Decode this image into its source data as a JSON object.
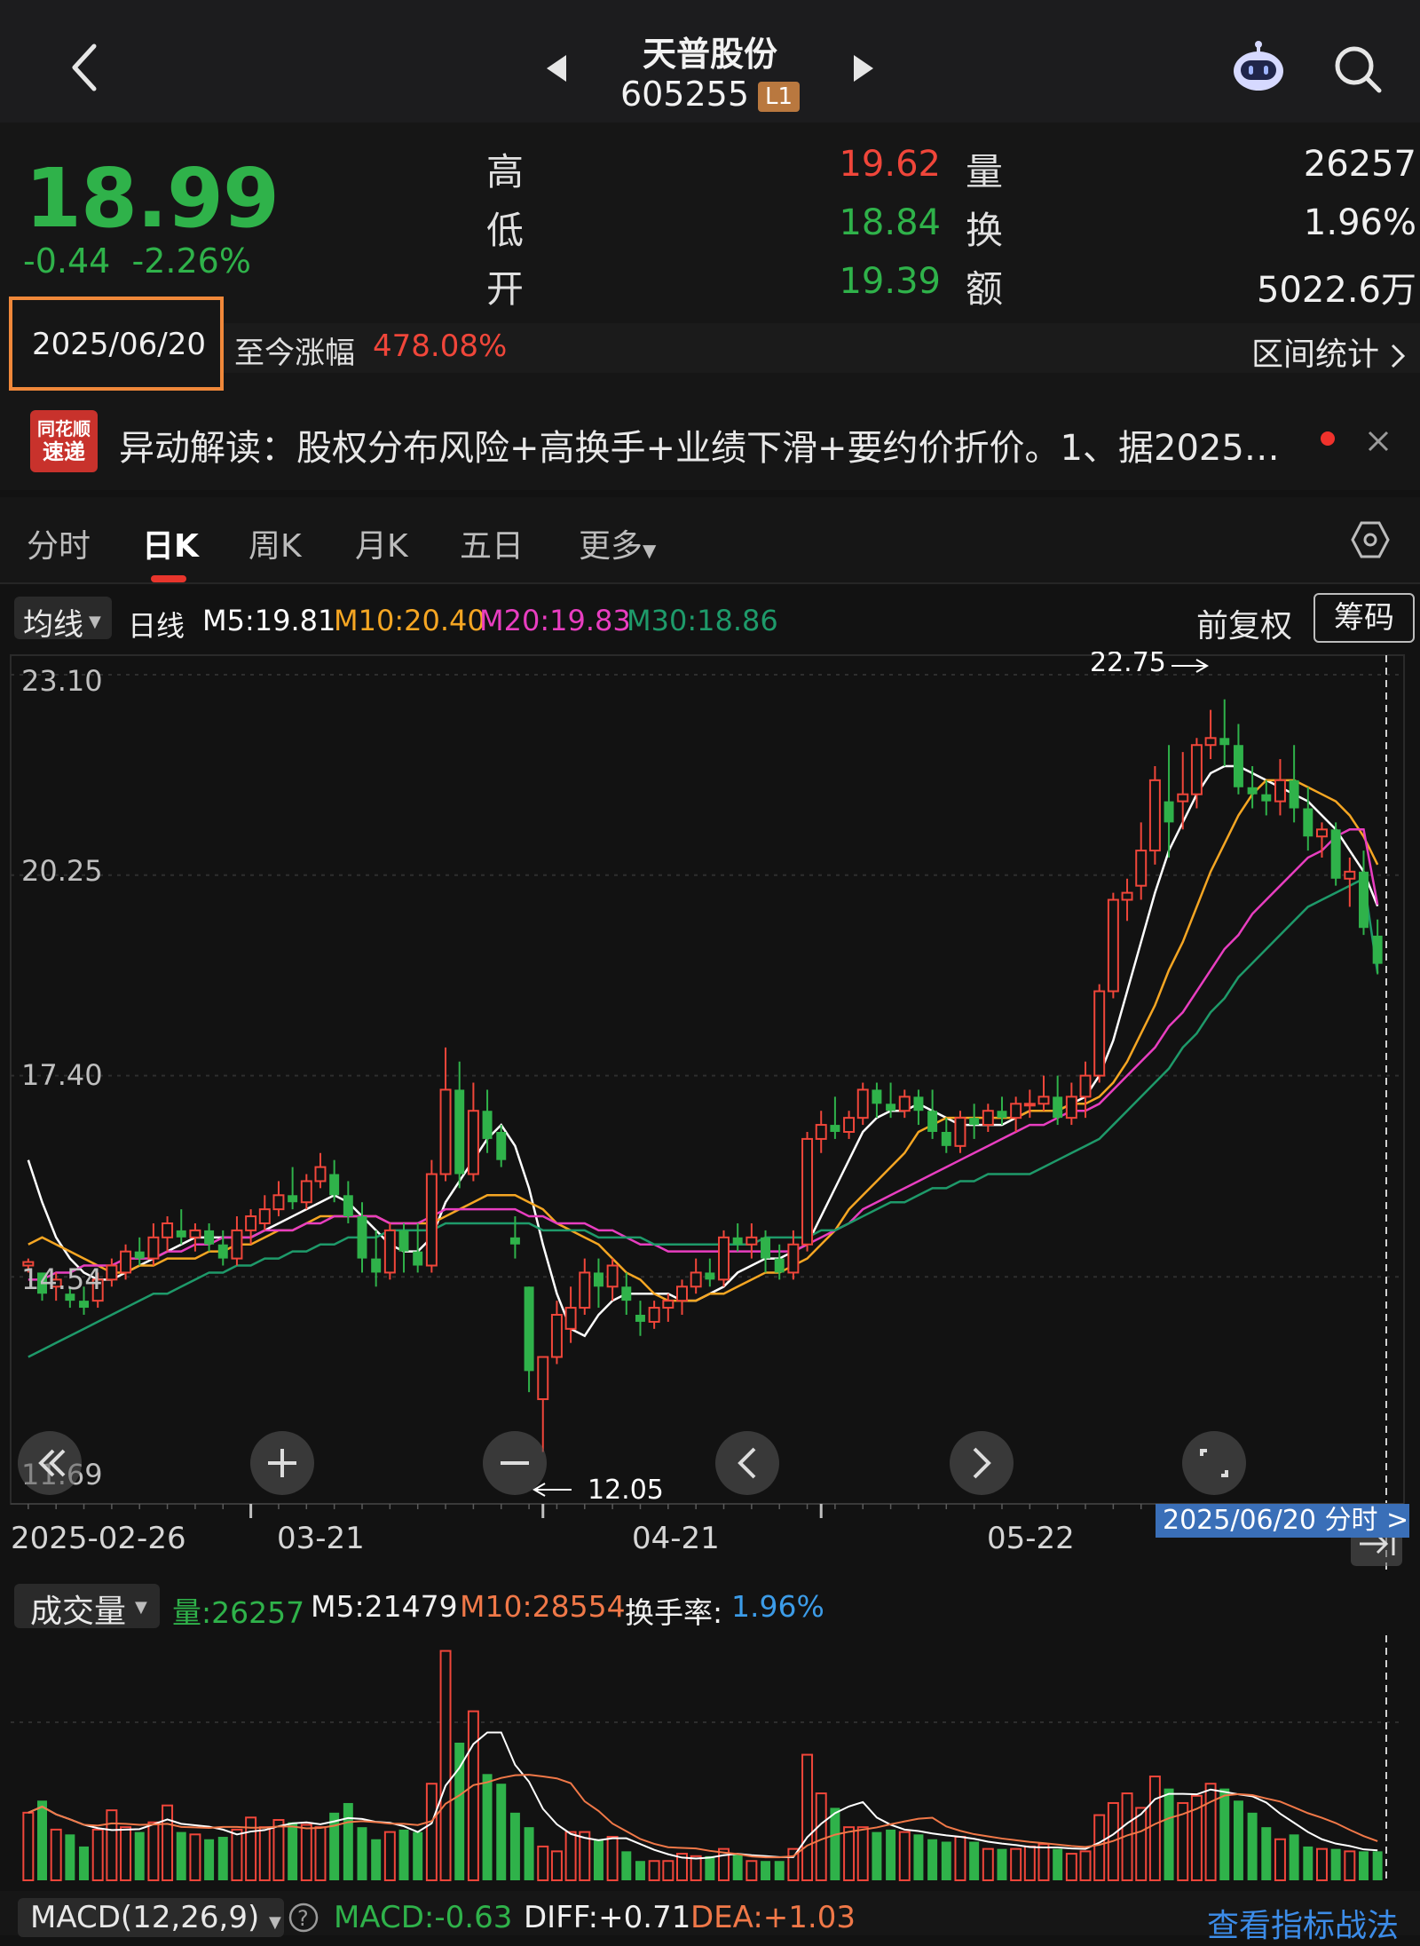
{
  "header": {
    "title": "天普股份",
    "code": "605255",
    "badge": "L1"
  },
  "quote": {
    "price": "18.99",
    "change": "-0.44",
    "change_pct": "-2.26%",
    "high_label": "高",
    "high": "19.62",
    "low_label": "低",
    "low": "18.84",
    "open_label": "开",
    "open": "19.39",
    "vol_label": "量",
    "vol": "26257",
    "turn_label": "换",
    "turn": "1.96%",
    "amt_label": "额",
    "amt": "5022.6万",
    "date": "2025/06/20",
    "since_label": "至今涨幅",
    "since_value": "478.08%",
    "interval_label": "区间统计"
  },
  "news": {
    "logo_top": "同花顺",
    "logo_bottom": "速递",
    "text": "异动解读：股权分布风险+高换手+业绩下滑+要约价折价。1、据2025…"
  },
  "tabs": [
    {
      "label": "分时"
    },
    {
      "label": "日K"
    },
    {
      "label": "周K"
    },
    {
      "label": "月K"
    },
    {
      "label": "五日"
    },
    {
      "label": "更多"
    }
  ],
  "ma": {
    "select": "均线",
    "period": "日线",
    "m5": "M5:19.81",
    "m10": "M10:20.40",
    "m20": "M20:19.83",
    "m30": "M30:18.86",
    "adjust": "前复权",
    "chips": "筹码"
  },
  "colors": {
    "up": "#f0463a",
    "down": "#2fb24a",
    "m5": "#ffffff",
    "m10": "#f5a623",
    "m20": "#e83ec0",
    "m30": "#1e9a6a"
  },
  "chart_data": {
    "type": "candlestick",
    "y_ticks": [
      "23.10",
      "20.25",
      "17.40",
      "14.54",
      "11.69"
    ],
    "ylim": [
      11.69,
      23.1
    ],
    "x_ticks": [
      "2025-02-26",
      "03-21",
      "04-21",
      "05-22"
    ],
    "max_label": "22.75",
    "min_label": "12.05",
    "cursor_date": "2025/06/20 分时",
    "candles": [
      [
        14.7,
        14.8,
        14.6,
        14.75
      ],
      [
        14.6,
        14.6,
        14.2,
        14.3
      ],
      [
        14.4,
        14.6,
        14.2,
        14.5
      ],
      [
        14.3,
        14.4,
        14.1,
        14.2
      ],
      [
        14.2,
        14.4,
        14.0,
        14.1
      ],
      [
        14.2,
        14.6,
        14.1,
        14.5
      ],
      [
        14.5,
        14.8,
        14.4,
        14.7
      ],
      [
        14.6,
        15.0,
        14.5,
        14.9
      ],
      [
        14.9,
        15.1,
        14.7,
        14.8
      ],
      [
        14.8,
        15.3,
        14.7,
        15.1
      ],
      [
        15.1,
        15.4,
        14.9,
        15.3
      ],
      [
        15.2,
        15.5,
        15.0,
        15.1
      ],
      [
        15.1,
        15.3,
        14.9,
        15.2
      ],
      [
        15.2,
        15.3,
        14.9,
        15.0
      ],
      [
        15.0,
        15.2,
        14.7,
        14.8
      ],
      [
        14.8,
        15.4,
        14.7,
        15.2
      ],
      [
        15.2,
        15.5,
        15.0,
        15.4
      ],
      [
        15.3,
        15.7,
        15.2,
        15.5
      ],
      [
        15.5,
        15.9,
        15.4,
        15.7
      ],
      [
        15.7,
        16.1,
        15.5,
        15.6
      ],
      [
        15.6,
        16.0,
        15.5,
        15.9
      ],
      [
        15.9,
        16.3,
        15.8,
        16.1
      ],
      [
        16.0,
        16.2,
        15.6,
        15.7
      ],
      [
        15.7,
        15.9,
        15.3,
        15.4
      ],
      [
        15.4,
        15.6,
        14.6,
        14.8
      ],
      [
        14.8,
        15.2,
        14.4,
        14.6
      ],
      [
        14.6,
        15.3,
        14.5,
        15.2
      ],
      [
        15.2,
        15.3,
        14.6,
        14.9
      ],
      [
        14.9,
        15.3,
        14.6,
        14.7
      ],
      [
        14.7,
        16.2,
        14.6,
        16.0
      ],
      [
        16.0,
        17.8,
        15.9,
        17.2
      ],
      [
        17.2,
        17.6,
        15.8,
        16.0
      ],
      [
        16.0,
        17.3,
        15.9,
        16.9
      ],
      [
        16.9,
        17.2,
        16.3,
        16.5
      ],
      [
        16.6,
        16.7,
        16.1,
        16.2
      ],
      [
        15.1,
        15.4,
        14.8,
        15.0
      ],
      [
        14.4,
        14.4,
        12.9,
        13.2
      ],
      [
        12.8,
        13.4,
        12.05,
        13.4
      ],
      [
        13.4,
        14.2,
        13.3,
        14.0
      ],
      [
        13.8,
        14.4,
        13.6,
        14.1
      ],
      [
        14.1,
        14.8,
        14.0,
        14.6
      ],
      [
        14.6,
        14.8,
        14.1,
        14.4
      ],
      [
        14.4,
        14.8,
        14.2,
        14.7
      ],
      [
        14.4,
        14.6,
        14.0,
        14.2
      ],
      [
        14.0,
        14.2,
        13.7,
        13.9
      ],
      [
        13.9,
        14.2,
        13.8,
        14.1
      ],
      [
        14.1,
        14.3,
        13.9,
        14.2
      ],
      [
        14.2,
        14.5,
        14.0,
        14.4
      ],
      [
        14.4,
        14.8,
        14.3,
        14.6
      ],
      [
        14.6,
        14.8,
        14.4,
        14.5
      ],
      [
        14.5,
        15.2,
        14.4,
        15.1
      ],
      [
        15.1,
        15.3,
        14.9,
        15.0
      ],
      [
        15.0,
        15.3,
        14.8,
        15.1
      ],
      [
        15.1,
        15.2,
        14.6,
        14.8
      ],
      [
        14.8,
        15.0,
        14.5,
        14.6
      ],
      [
        14.6,
        15.2,
        14.5,
        15.0
      ],
      [
        15.0,
        16.6,
        14.9,
        16.5
      ],
      [
        16.5,
        16.9,
        16.3,
        16.7
      ],
      [
        16.7,
        17.1,
        16.5,
        16.6
      ],
      [
        16.6,
        16.9,
        16.5,
        16.8
      ],
      [
        16.8,
        17.3,
        16.7,
        17.2
      ],
      [
        17.2,
        17.3,
        16.8,
        17.0
      ],
      [
        17.0,
        17.3,
        16.8,
        16.9
      ],
      [
        16.9,
        17.2,
        16.8,
        17.1
      ],
      [
        17.1,
        17.2,
        16.7,
        16.9
      ],
      [
        16.9,
        17.2,
        16.5,
        16.6
      ],
      [
        16.6,
        16.8,
        16.3,
        16.4
      ],
      [
        16.4,
        16.9,
        16.3,
        16.8
      ],
      [
        16.8,
        17.0,
        16.5,
        16.7
      ],
      [
        16.7,
        17.0,
        16.6,
        16.9
      ],
      [
        16.9,
        17.1,
        16.7,
        16.8
      ],
      [
        16.8,
        17.1,
        16.6,
        17.0
      ],
      [
        17.0,
        17.2,
        16.8,
        17.0
      ],
      [
        17.0,
        17.4,
        16.9,
        17.1
      ],
      [
        17.1,
        17.4,
        16.7,
        16.8
      ],
      [
        16.8,
        17.3,
        16.7,
        17.1
      ],
      [
        17.1,
        17.6,
        16.8,
        17.4
      ],
      [
        17.4,
        18.7,
        17.3,
        18.6
      ],
      [
        18.6,
        20.0,
        18.5,
        19.9
      ],
      [
        19.9,
        20.2,
        19.6,
        20.0
      ],
      [
        20.1,
        21.0,
        19.9,
        20.6
      ],
      [
        20.6,
        21.8,
        20.4,
        21.6
      ],
      [
        21.3,
        22.1,
        20.5,
        21.0
      ],
      [
        21.3,
        22.0,
        20.9,
        21.4
      ],
      [
        21.4,
        22.2,
        21.2,
        22.1
      ],
      [
        22.1,
        22.6,
        21.9,
        22.2
      ],
      [
        22.2,
        22.75,
        21.8,
        22.1
      ],
      [
        22.1,
        22.4,
        21.4,
        21.5
      ],
      [
        21.5,
        21.8,
        21.2,
        21.4
      ],
      [
        21.4,
        21.6,
        21.1,
        21.3
      ],
      [
        21.3,
        21.9,
        21.1,
        21.6
      ],
      [
        21.6,
        22.1,
        21.0,
        21.2
      ],
      [
        21.2,
        21.5,
        20.6,
        20.8
      ],
      [
        20.8,
        21.0,
        20.5,
        20.9
      ],
      [
        20.9,
        21.0,
        20.1,
        20.2
      ],
      [
        20.2,
        20.5,
        19.8,
        20.3
      ],
      [
        20.3,
        20.6,
        19.4,
        19.5
      ],
      [
        19.39,
        19.62,
        18.84,
        18.99
      ]
    ],
    "series": [
      {
        "name": "M5",
        "values": [
          16.2,
          15.6,
          15.1,
          14.8,
          14.6,
          14.5,
          14.5,
          14.6,
          14.7,
          14.8,
          14.9,
          15.0,
          15.1,
          15.1,
          15.1,
          15.1,
          15.1,
          15.2,
          15.3,
          15.4,
          15.5,
          15.6,
          15.7,
          15.6,
          15.4,
          15.2,
          15.0,
          14.9,
          14.9,
          15.1,
          15.6,
          15.9,
          16.2,
          16.5,
          16.7,
          16.4,
          15.8,
          15.0,
          14.3,
          13.8,
          13.7,
          14.0,
          14.2,
          14.3,
          14.3,
          14.3,
          14.3,
          14.2,
          14.2,
          14.3,
          14.4,
          14.6,
          14.7,
          14.8,
          14.8,
          14.9,
          15.0,
          15.4,
          15.8,
          16.2,
          16.6,
          16.8,
          16.9,
          16.9,
          17.0,
          16.9,
          16.8,
          16.7,
          16.7,
          16.7,
          16.7,
          16.8,
          16.9,
          16.9,
          16.9,
          17.0,
          17.1,
          17.4,
          17.9,
          18.6,
          19.3,
          20.0,
          20.6,
          21.0,
          21.4,
          21.7,
          21.8,
          21.8,
          21.7,
          21.6,
          21.5,
          21.4,
          21.3,
          21.1,
          20.9,
          20.6,
          20.3,
          19.81
        ]
      },
      {
        "name": "M10",
        "values": [
          15.0,
          15.1,
          15.0,
          14.9,
          14.8,
          14.7,
          14.6,
          14.6,
          14.7,
          14.7,
          14.8,
          14.8,
          14.8,
          14.9,
          14.9,
          15.0,
          15.0,
          15.1,
          15.2,
          15.2,
          15.3,
          15.4,
          15.4,
          15.4,
          15.4,
          15.4,
          15.3,
          15.3,
          15.3,
          15.3,
          15.4,
          15.5,
          15.6,
          15.7,
          15.7,
          15.7,
          15.6,
          15.5,
          15.3,
          15.2,
          15.1,
          15.0,
          14.8,
          14.6,
          14.5,
          14.3,
          14.2,
          14.2,
          14.2,
          14.3,
          14.3,
          14.4,
          14.5,
          14.6,
          14.6,
          14.7,
          14.8,
          15.0,
          15.2,
          15.5,
          15.7,
          15.9,
          16.1,
          16.3,
          16.6,
          16.7,
          16.8,
          16.8,
          16.8,
          16.8,
          16.8,
          16.8,
          16.9,
          16.9,
          16.9,
          17.0,
          17.0,
          17.1,
          17.3,
          17.6,
          18.0,
          18.4,
          18.9,
          19.3,
          19.8,
          20.3,
          20.7,
          21.1,
          21.4,
          21.6,
          21.6,
          21.6,
          21.5,
          21.4,
          21.3,
          21.1,
          20.8,
          20.4
        ]
      },
      {
        "name": "M20",
        "values": [
          14.5,
          14.5,
          14.6,
          14.6,
          14.7,
          14.7,
          14.7,
          14.8,
          14.8,
          14.8,
          14.9,
          14.9,
          15.0,
          15.0,
          15.1,
          15.1,
          15.1,
          15.2,
          15.2,
          15.2,
          15.3,
          15.3,
          15.4,
          15.4,
          15.4,
          15.4,
          15.3,
          15.3,
          15.3,
          15.4,
          15.5,
          15.5,
          15.5,
          15.5,
          15.5,
          15.5,
          15.4,
          15.4,
          15.3,
          15.3,
          15.3,
          15.2,
          15.2,
          15.1,
          15.0,
          15.0,
          14.9,
          14.9,
          14.9,
          14.9,
          14.9,
          14.9,
          14.9,
          14.9,
          14.9,
          14.9,
          15.0,
          15.1,
          15.2,
          15.3,
          15.5,
          15.6,
          15.7,
          15.8,
          15.9,
          16.0,
          16.1,
          16.2,
          16.3,
          16.4,
          16.5,
          16.6,
          16.7,
          16.7,
          16.8,
          16.9,
          16.9,
          17.0,
          17.2,
          17.4,
          17.6,
          17.8,
          18.1,
          18.3,
          18.6,
          18.9,
          19.2,
          19.4,
          19.7,
          19.9,
          20.1,
          20.3,
          20.5,
          20.6,
          20.8,
          20.9,
          20.9,
          19.83
        ]
      },
      {
        "name": "M30",
        "values": [
          13.4,
          13.5,
          13.6,
          13.7,
          13.8,
          13.9,
          14.0,
          14.1,
          14.2,
          14.3,
          14.3,
          14.4,
          14.5,
          14.6,
          14.6,
          14.7,
          14.7,
          14.8,
          14.8,
          14.9,
          14.9,
          15.0,
          15.0,
          15.1,
          15.1,
          15.1,
          15.2,
          15.2,
          15.2,
          15.2,
          15.3,
          15.3,
          15.3,
          15.3,
          15.3,
          15.3,
          15.3,
          15.2,
          15.2,
          15.2,
          15.2,
          15.1,
          15.1,
          15.1,
          15.1,
          15.0,
          15.0,
          15.0,
          15.0,
          15.0,
          15.0,
          15.0,
          15.0,
          15.1,
          15.1,
          15.1,
          15.1,
          15.2,
          15.2,
          15.3,
          15.4,
          15.5,
          15.6,
          15.6,
          15.7,
          15.8,
          15.8,
          15.9,
          15.9,
          16.0,
          16.0,
          16.0,
          16.0,
          16.1,
          16.2,
          16.3,
          16.4,
          16.5,
          16.7,
          16.9,
          17.1,
          17.3,
          17.5,
          17.8,
          18.0,
          18.3,
          18.5,
          18.8,
          19.0,
          19.2,
          19.4,
          19.6,
          19.8,
          19.9,
          20.0,
          20.1,
          20.2,
          18.86
        ]
      }
    ]
  },
  "volume": {
    "select": "成交量",
    "vol": "量:26257",
    "m5": "M5:21479",
    "m10": "M10:28554",
    "turnover_label": "换手率:",
    "turnover": "1.96%",
    "values": [
      28,
      33,
      21,
      19,
      14,
      21,
      29,
      22,
      20,
      24,
      31,
      20,
      19,
      17,
      18,
      21,
      26,
      22,
      25,
      24,
      23,
      22,
      28,
      32,
      22,
      17,
      20,
      21,
      20,
      40,
      95,
      57,
      70,
      44,
      40,
      28,
      22,
      14,
      12,
      20,
      20,
      17,
      18,
      12,
      8,
      8,
      8,
      11,
      10,
      10,
      13,
      11,
      8,
      8,
      8,
      13,
      52,
      36,
      30,
      22,
      22,
      20,
      21,
      20,
      19,
      17,
      16,
      18,
      16,
      13,
      13,
      13,
      14,
      15,
      13,
      11,
      12,
      27,
      32,
      36,
      30,
      43,
      38,
      32,
      35,
      40,
      38,
      33,
      28,
      22,
      17,
      19,
      14,
      13,
      13,
      12,
      12,
      12
    ]
  },
  "macd": {
    "select": "MACD(12,26,9)",
    "macd": "MACD:-0.63",
    "diff": "DIFF:+0.71",
    "dea": "DEA:+1.03",
    "link": "查看指标战法"
  }
}
